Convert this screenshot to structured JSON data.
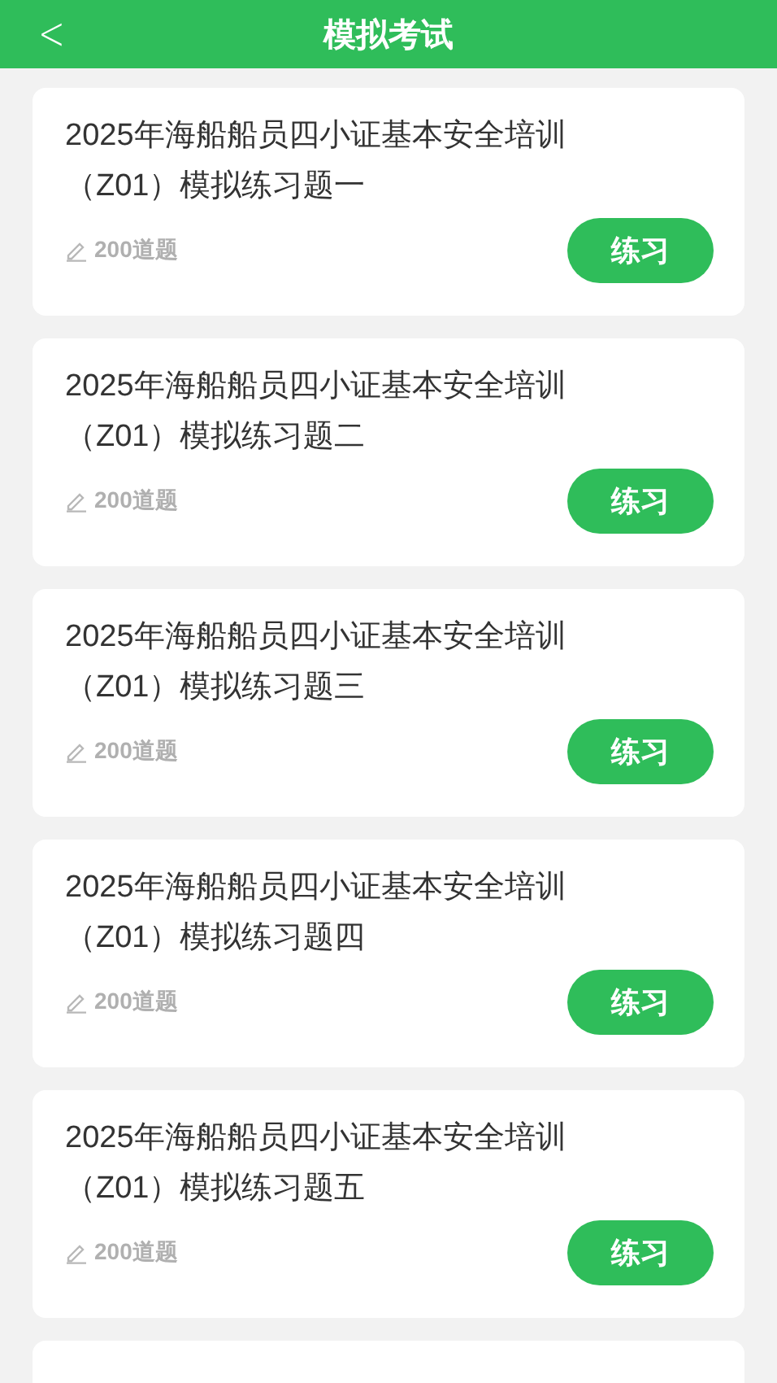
{
  "header": {
    "back": "<",
    "title": "模拟考试"
  },
  "exams": [
    {
      "title": "2025年海船船员四小证基本安全培训（Z01）模拟练习题一",
      "count": "200道题",
      "action": "练习"
    },
    {
      "title": "2025年海船船员四小证基本安全培训（Z01）模拟练习题二",
      "count": "200道题",
      "action": "练习"
    },
    {
      "title": "2025年海船船员四小证基本安全培训（Z01）模拟练习题三",
      "count": "200道题",
      "action": "练习"
    },
    {
      "title": "2025年海船船员四小证基本安全培训（Z01）模拟练习题四",
      "count": "200道题",
      "action": "练习"
    },
    {
      "title": "2025年海船船员四小证基本安全培训（Z01）模拟练习题五",
      "count": "200道题",
      "action": "练习"
    }
  ]
}
